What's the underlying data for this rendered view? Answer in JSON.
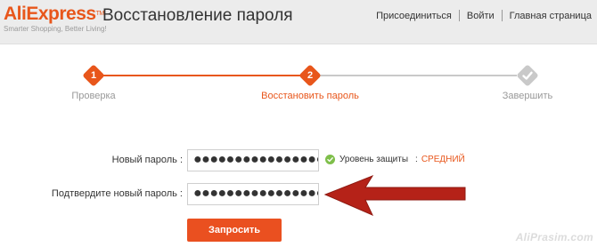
{
  "header": {
    "logo": {
      "brand": "AliExpress",
      "tm": "TM",
      "tagline": "Smarter Shopping, Better Living!"
    },
    "title": "Восстановление пароля",
    "nav": [
      "Присоединиться",
      "Войти",
      "Главная страница"
    ]
  },
  "steps": [
    {
      "number": "1",
      "label": "Проверка",
      "state": "done"
    },
    {
      "number": "2",
      "label": "Восстановить пароль",
      "state": "active"
    },
    {
      "number": "",
      "label": "Завершить",
      "state": "pending"
    }
  ],
  "form": {
    "new_password_label": "Новый пароль :",
    "new_password_value": "●●●●●●●●●●●●●●●●●",
    "confirm_password_label": "Подтвердите новый пароль :",
    "confirm_password_value": "●●●●●●●●●●●●●●●●●",
    "strength_label": "Уровень защиты",
    "strength_colon": ":",
    "strength_level": "СРЕДНИЙ",
    "submit_label": "Запросить"
  },
  "watermark": "AliPrasim.com",
  "colors": {
    "accent": "#e8561b",
    "arrow": "#b52218",
    "check": "#7fbf4b",
    "inactive": "#c9c9c9"
  },
  "icons": [
    "check-circle-icon",
    "pointer-arrow-icon"
  ]
}
